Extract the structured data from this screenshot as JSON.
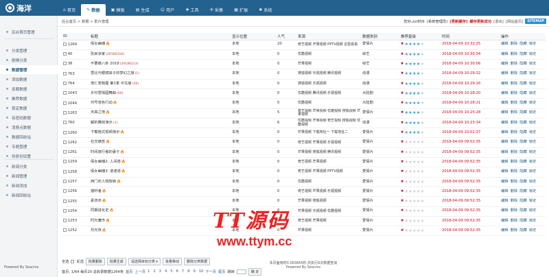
{
  "logo": {
    "text": "海洋"
  },
  "nav": [
    {
      "icon": "home-icon",
      "glyph": "⌂",
      "label": "首页",
      "active": false
    },
    {
      "icon": "edit-icon",
      "glyph": "✎",
      "label": "数据",
      "active": true
    },
    {
      "icon": "template-icon",
      "glyph": "▣",
      "label": "模板",
      "active": false
    },
    {
      "icon": "document-icon",
      "glyph": "▤",
      "label": "生成",
      "active": false
    },
    {
      "icon": "user-icon",
      "glyph": "☺",
      "label": "用户",
      "active": false
    },
    {
      "icon": "tools-icon",
      "glyph": "✚",
      "label": "工具",
      "active": false
    },
    {
      "icon": "collect-icon",
      "glyph": "✣",
      "label": "采集",
      "active": false
    },
    {
      "icon": "extend-icon",
      "glyph": "▦",
      "label": "扩展",
      "active": false
    },
    {
      "icon": "gear-icon",
      "glyph": "✱",
      "label": "系统",
      "active": false
    }
  ],
  "sidebar": {
    "items": [
      "后台首页管理",
      "分类管理",
      "剧情分类",
      "数据管理",
      "添加数据",
      "连载数据",
      "推荐数据",
      "锁定数据",
      "有密码数据",
      "消费点数据",
      "数据回收站",
      "专题管理",
      "伪原创设置",
      "新闻分类",
      "新闻管理",
      "新闻添加",
      "新闻回收站"
    ],
    "active_index": 3,
    "powered": "Powered By Seacms"
  },
  "breadcrumb": "后台首页 > 数据 > 影片管理",
  "userbar": {
    "welcome": "您好,zxt856",
    "role": "(系统管理员)",
    "update_cache": "[更新缓存]",
    "cache_done": "缓存更新成功",
    "logout": "[退出]",
    "site_home": "[网站首页]",
    "sitemap": "SITEMAP"
  },
  "table": {
    "headers": [
      "ID",
      "标题",
      "",
      "显示位置",
      "人气",
      "来源",
      "数据类别",
      "推荐星级",
      "时间",
      "操作"
    ],
    "rows": [
      {
        "id": "1264",
        "title": "倩女幽魂",
        "tag": "",
        "fire": true,
        "pos": "本地",
        "hits": "20",
        "src": "奇艺视频 芒果视频 PPTV视频 迅雷看看",
        "cat": "爱情片",
        "stars": 4,
        "time": "2018-04-09 10:32:25"
      },
      {
        "id": "40",
        "title": "张启凉家",
        "tag": "(20180316)",
        "fire": false,
        "pos": "本地",
        "hits": "0",
        "src": "优酷视频",
        "cat": "综艺",
        "stars": 4,
        "time": "2018-04-09 10:30:34"
      },
      {
        "id": "38",
        "title": "不要痛八卦 2018",
        "tag": "(20180213)",
        "fire": false,
        "pos": "本地",
        "hits": "0",
        "src": "芒果视频",
        "cat": "综艺",
        "stars": 4,
        "time": "2018-04-09 10:30:06"
      },
      {
        "id": "763",
        "title": "雪比与眼镜来子的梦幻之旅",
        "tag": "(1)",
        "fire": false,
        "pos": "本地",
        "hits": "0",
        "src": "搜狐视频 乐视视频 腾讯视频",
        "cat": "动漫",
        "stars": 4,
        "time": "2018-04-09 10:29:32"
      },
      {
        "id": "764",
        "title": "宠仁宠物屋 第1季 中文版",
        "tag": "(26)",
        "fire": false,
        "pos": "本地",
        "hits": "0",
        "src": "搜狐视频 乐视视频",
        "cat": "动漫",
        "stars": 4,
        "time": "2018-04-09 10:29:16"
      },
      {
        "id": "1043",
        "title": "乡村爱情圆舞曲",
        "tag": "(60)",
        "fire": false,
        "pos": "本地",
        "hits": "0",
        "src": "优酷视频 腾讯视频 乐视视频",
        "cat": "大陆剧",
        "stars": 4,
        "time": "2018-04-09 10:28:20"
      },
      {
        "id": "1044",
        "title": "代号苍色行动",
        "tag": "",
        "fire": true,
        "pos": "本地",
        "hits": "0",
        "src": "优酷视频",
        "cat": "大陆剧",
        "stars": 4,
        "time": "2018-04-09 10:28:21"
      },
      {
        "id": "1263",
        "title": "天高之地",
        "tag": "",
        "fire": true,
        "pos": "本地",
        "hits": "5",
        "src": "奇艺视频 芒果视频 优酷视频 搜狐视频 芒果视频",
        "cat": "爱情片",
        "stars": 4,
        "time": "2018-04-09 10:25:28"
      },
      {
        "id": "760",
        "title": "解析腾效演示",
        "tag": "(1)",
        "fire": false,
        "pos": "本地",
        "hits": "6",
        "src": "优酷视频 芒果视频 奇艺视频 搜狐视频 优酷视频",
        "cat": "动漫",
        "stars": 4,
        "time": "2018-04-09 10:23:34"
      },
      {
        "id": "1260",
        "title": "下载格式视频演示",
        "tag": "",
        "fire": true,
        "pos": "本地",
        "hits": "0",
        "src": "芒果视频 下载地址一 下载地址二",
        "cat": "爱情片",
        "stars": 4,
        "time": "2018-04-09 10:02:37"
      },
      {
        "id": "1262",
        "title": "社交痛苦",
        "tag": "",
        "fire": true,
        "pos": "本地",
        "hits": "0",
        "src": "奇艺视频 芒果视频 乐视视频",
        "cat": "爱情片",
        "stars": 0,
        "time": "2018-04-09 09:52:35"
      },
      {
        "id": "1261",
        "title": "时间旅行者的妻子",
        "tag": "",
        "fire": true,
        "pos": "本地",
        "hits": "0",
        "src": "芒果视频 搜狐视频 腾讯视频",
        "cat": "爱情片",
        "stars": 0,
        "time": "2018-04-09 09:52:35"
      },
      {
        "id": "1259",
        "title": "倩女幽魂2: 人间道",
        "tag": "",
        "fire": true,
        "pos": "本地",
        "hits": "0",
        "src": "奇艺视频 芒果视频",
        "cat": "爱情片",
        "stars": 0,
        "time": "2018-04-09 09:52:35"
      },
      {
        "id": "1258",
        "title": "倩女幽魂3: 道道道",
        "tag": "",
        "fire": true,
        "pos": "本地",
        "hits": "0",
        "src": "奇艺视频 芒果视频 PPTV视频",
        "cat": "爱情片",
        "stars": 0,
        "time": "2018-04-09 09:52:35"
      },
      {
        "id": "1257",
        "title": "西门庆人物放映",
        "tag": "",
        "fire": true,
        "pos": "本地",
        "hits": "0",
        "src": "优酷视频",
        "cat": "爱情片",
        "stars": 0,
        "time": "2018-04-09 09:52:35"
      },
      {
        "id": "1256",
        "title": "猎听者",
        "tag": "",
        "fire": true,
        "pos": "本地",
        "hits": "0",
        "src": "奇艺视频 芒果视频 乐视视频",
        "cat": "爱情片",
        "stars": 0,
        "time": "2018-04-09 09:52:35"
      },
      {
        "id": "1255",
        "title": "素双步",
        "tag": "",
        "fire": true,
        "pos": "本地",
        "hits": "0",
        "src": "芒果视频 搜狐视频",
        "cat": "爱情片",
        "stars": 0,
        "time": "2018-04-09 09:52:35"
      },
      {
        "id": "1254",
        "title": "同期进化史",
        "tag": "",
        "fire": true,
        "pos": "本地",
        "hits": "0",
        "src": "芒果视频 乐视视频 优酷视频",
        "cat": "爱情片",
        "stars": 0,
        "time": "2018-04-09 09:52:35"
      },
      {
        "id": "1253",
        "title": "时光魔市",
        "tag": "",
        "fire": true,
        "pos": "本地",
        "hits": "0",
        "src": "奇艺视频 芒果视频",
        "cat": "爱情片",
        "stars": 0,
        "time": "2018-04-09 09:52:35"
      },
      {
        "id": "1252",
        "title": "月光侠",
        "tag": "",
        "fire": true,
        "pos": "本地",
        "hits": "0",
        "src": "芒果视频",
        "cat": "爱情片",
        "stars": 0,
        "time": "2018-04-09 09:52:35"
      }
    ],
    "ops": [
      "编辑",
      "删除",
      "隐藏",
      "锁定"
    ]
  },
  "bulk": {
    "select_all": "全选",
    "invert": "反选",
    "btn_delete": "批量删除",
    "btn_generate": "批量生成",
    "select_category": "请选择目标分类",
    "btn_move": "批量移动",
    "btn_delete_category": "删除分类数据"
  },
  "pager": {
    "info": "首页: 1/64 每页20 总收录数据1264条",
    "first": "首页",
    "prev": "上一页",
    "pages": [
      "1",
      "2",
      "3",
      "4",
      "5",
      "6",
      "7",
      "8",
      "9",
      "10"
    ],
    "next": "下一页",
    "last": "尾页",
    "jump": "跳转",
    "go": "确 定"
  },
  "footer": {
    "line1": "本页面用时0.063665秒,共执行6次数据查询",
    "line2": "Powered By Seacms"
  },
  "watermark": {
    "title": "TT源码",
    "url": "www.ttym.cc"
  }
}
